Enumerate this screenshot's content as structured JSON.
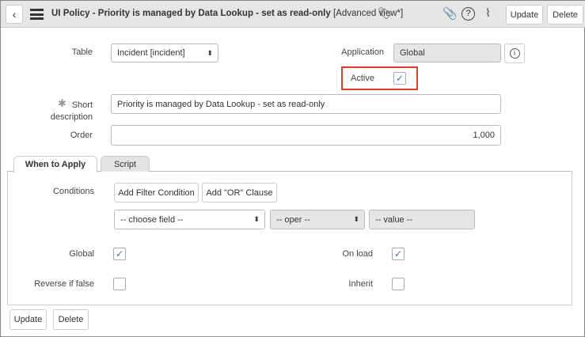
{
  "header": {
    "title": "UI Policy - Priority is managed by Data Lookup - set as read-only",
    "view": "[Advanced view*]",
    "update": "Update",
    "delete": "Delete"
  },
  "form": {
    "table_label": "Table",
    "table_value": "Incident [incident]",
    "application_label": "Application",
    "application_value": "Global",
    "active_label": "Active",
    "active_checked": true,
    "short_desc_label": "Short description",
    "short_desc_value": "Priority is managed by Data Lookup - set as read-only",
    "order_label": "Order",
    "order_value": "1,000"
  },
  "tabs": [
    {
      "label": "When to Apply"
    },
    {
      "label": "Script"
    }
  ],
  "conditions": {
    "label": "Conditions",
    "add_filter": "Add Filter Condition",
    "add_or": "Add \"OR\" Clause",
    "field": "-- choose field --",
    "oper": "-- oper --",
    "value": "-- value --"
  },
  "options": {
    "global_label": "Global",
    "global": true,
    "onload_label": "On load",
    "onload": true,
    "reverse_label": "Reverse if false",
    "reverse": false,
    "inherit_label": "Inherit",
    "inherit": false
  },
  "footer": {
    "update": "Update",
    "delete": "Delete"
  },
  "colors": {
    "highlight": "#d9412b",
    "check": "#3a7ab8"
  }
}
